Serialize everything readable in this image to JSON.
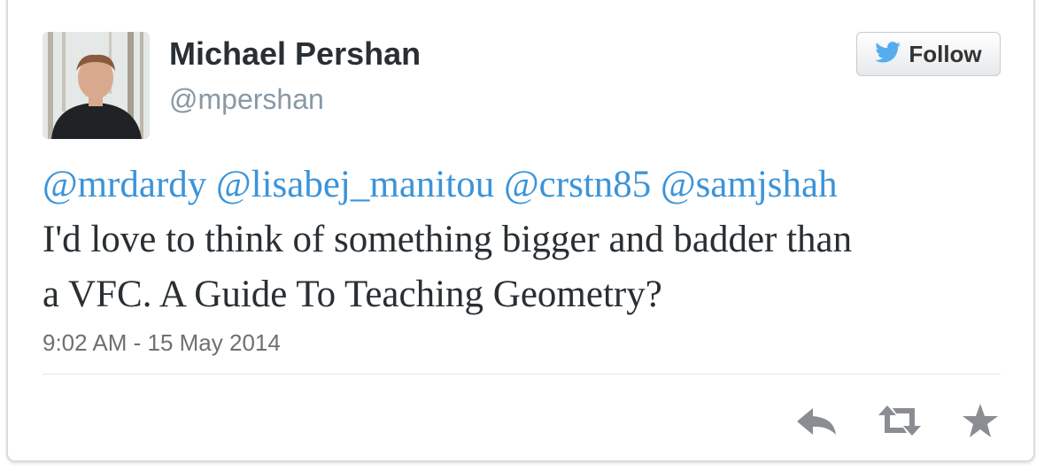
{
  "user": {
    "display_name": "Michael Pershan",
    "screen_name": "@mpershan"
  },
  "follow_button": {
    "label": "Follow",
    "icon": "twitter-bird-icon"
  },
  "tweet": {
    "mentions": [
      "@mrdardy",
      "@lisabej_manitou",
      "@crstn85",
      "@samjshah"
    ],
    "line1": "I'd love to think of something bigger and badder than",
    "line2": "a VFC. A Guide To Teaching Geometry?",
    "timestamp": "9:02 AM - 15 May 2014"
  },
  "actions": [
    {
      "name": "reply",
      "icon": "reply-icon"
    },
    {
      "name": "retweet",
      "icon": "retweet-icon"
    },
    {
      "name": "favorite",
      "icon": "star-icon"
    }
  ],
  "colors": {
    "link": "#3b94d9",
    "text": "#292f33",
    "muted": "#8899a6",
    "twitter_blue": "#55acee",
    "action_gray": "#8a8d91"
  }
}
